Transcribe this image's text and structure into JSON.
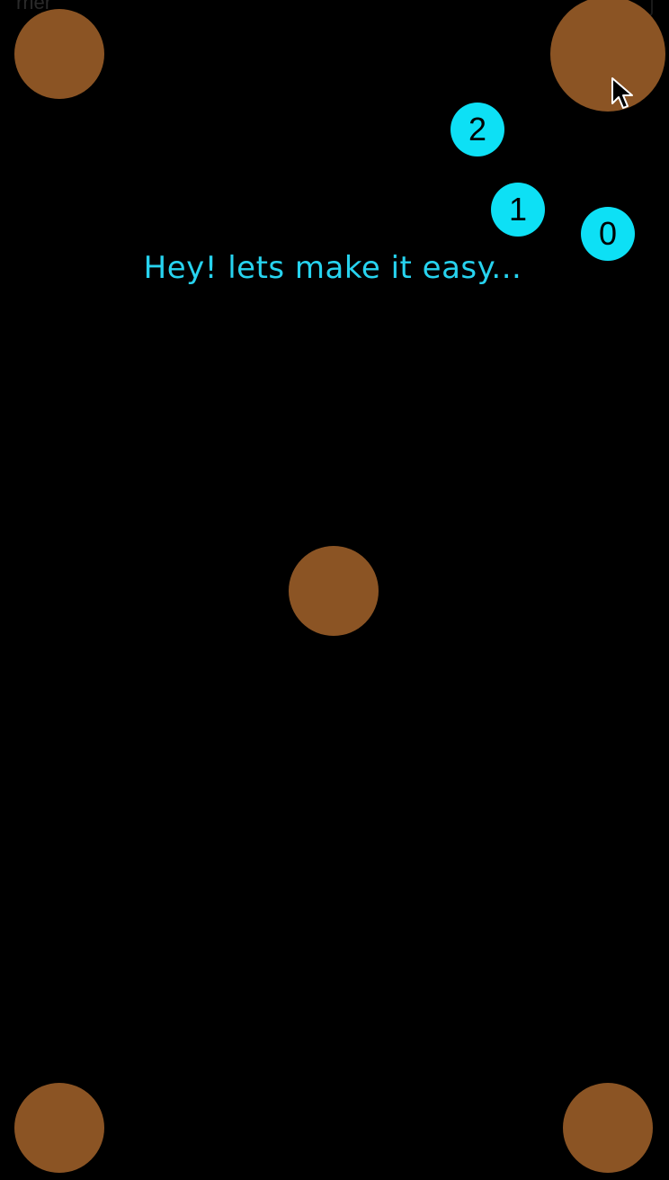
{
  "status_bar": {
    "carrier_text": "rrier"
  },
  "game": {
    "message": "Hey! lets make it easy...",
    "balls": [
      {
        "label": "2"
      },
      {
        "label": "1"
      },
      {
        "label": "0"
      }
    ],
    "colors": {
      "background": "#000000",
      "hole": "#8b5424",
      "ball": "#0de0f5",
      "message": "#27d3ef"
    }
  }
}
